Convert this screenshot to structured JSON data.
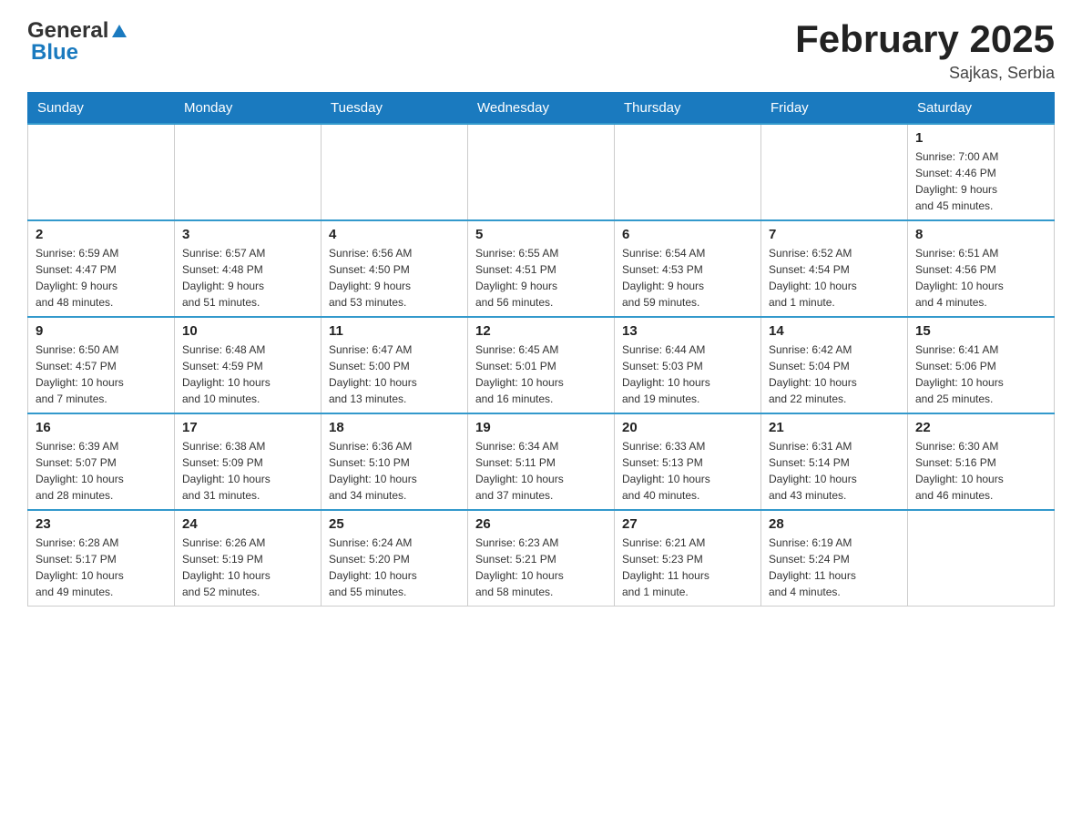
{
  "header": {
    "logo_general": "General",
    "logo_blue": "Blue",
    "title": "February 2025",
    "subtitle": "Sajkas, Serbia"
  },
  "days_of_week": [
    "Sunday",
    "Monday",
    "Tuesday",
    "Wednesday",
    "Thursday",
    "Friday",
    "Saturday"
  ],
  "weeks": [
    {
      "days": [
        {
          "num": "",
          "info": ""
        },
        {
          "num": "",
          "info": ""
        },
        {
          "num": "",
          "info": ""
        },
        {
          "num": "",
          "info": ""
        },
        {
          "num": "",
          "info": ""
        },
        {
          "num": "",
          "info": ""
        },
        {
          "num": "1",
          "info": "Sunrise: 7:00 AM\nSunset: 4:46 PM\nDaylight: 9 hours\nand 45 minutes."
        }
      ]
    },
    {
      "days": [
        {
          "num": "2",
          "info": "Sunrise: 6:59 AM\nSunset: 4:47 PM\nDaylight: 9 hours\nand 48 minutes."
        },
        {
          "num": "3",
          "info": "Sunrise: 6:57 AM\nSunset: 4:48 PM\nDaylight: 9 hours\nand 51 minutes."
        },
        {
          "num": "4",
          "info": "Sunrise: 6:56 AM\nSunset: 4:50 PM\nDaylight: 9 hours\nand 53 minutes."
        },
        {
          "num": "5",
          "info": "Sunrise: 6:55 AM\nSunset: 4:51 PM\nDaylight: 9 hours\nand 56 minutes."
        },
        {
          "num": "6",
          "info": "Sunrise: 6:54 AM\nSunset: 4:53 PM\nDaylight: 9 hours\nand 59 minutes."
        },
        {
          "num": "7",
          "info": "Sunrise: 6:52 AM\nSunset: 4:54 PM\nDaylight: 10 hours\nand 1 minute."
        },
        {
          "num": "8",
          "info": "Sunrise: 6:51 AM\nSunset: 4:56 PM\nDaylight: 10 hours\nand 4 minutes."
        }
      ]
    },
    {
      "days": [
        {
          "num": "9",
          "info": "Sunrise: 6:50 AM\nSunset: 4:57 PM\nDaylight: 10 hours\nand 7 minutes."
        },
        {
          "num": "10",
          "info": "Sunrise: 6:48 AM\nSunset: 4:59 PM\nDaylight: 10 hours\nand 10 minutes."
        },
        {
          "num": "11",
          "info": "Sunrise: 6:47 AM\nSunset: 5:00 PM\nDaylight: 10 hours\nand 13 minutes."
        },
        {
          "num": "12",
          "info": "Sunrise: 6:45 AM\nSunset: 5:01 PM\nDaylight: 10 hours\nand 16 minutes."
        },
        {
          "num": "13",
          "info": "Sunrise: 6:44 AM\nSunset: 5:03 PM\nDaylight: 10 hours\nand 19 minutes."
        },
        {
          "num": "14",
          "info": "Sunrise: 6:42 AM\nSunset: 5:04 PM\nDaylight: 10 hours\nand 22 minutes."
        },
        {
          "num": "15",
          "info": "Sunrise: 6:41 AM\nSunset: 5:06 PM\nDaylight: 10 hours\nand 25 minutes."
        }
      ]
    },
    {
      "days": [
        {
          "num": "16",
          "info": "Sunrise: 6:39 AM\nSunset: 5:07 PM\nDaylight: 10 hours\nand 28 minutes."
        },
        {
          "num": "17",
          "info": "Sunrise: 6:38 AM\nSunset: 5:09 PM\nDaylight: 10 hours\nand 31 minutes."
        },
        {
          "num": "18",
          "info": "Sunrise: 6:36 AM\nSunset: 5:10 PM\nDaylight: 10 hours\nand 34 minutes."
        },
        {
          "num": "19",
          "info": "Sunrise: 6:34 AM\nSunset: 5:11 PM\nDaylight: 10 hours\nand 37 minutes."
        },
        {
          "num": "20",
          "info": "Sunrise: 6:33 AM\nSunset: 5:13 PM\nDaylight: 10 hours\nand 40 minutes."
        },
        {
          "num": "21",
          "info": "Sunrise: 6:31 AM\nSunset: 5:14 PM\nDaylight: 10 hours\nand 43 minutes."
        },
        {
          "num": "22",
          "info": "Sunrise: 6:30 AM\nSunset: 5:16 PM\nDaylight: 10 hours\nand 46 minutes."
        }
      ]
    },
    {
      "days": [
        {
          "num": "23",
          "info": "Sunrise: 6:28 AM\nSunset: 5:17 PM\nDaylight: 10 hours\nand 49 minutes."
        },
        {
          "num": "24",
          "info": "Sunrise: 6:26 AM\nSunset: 5:19 PM\nDaylight: 10 hours\nand 52 minutes."
        },
        {
          "num": "25",
          "info": "Sunrise: 6:24 AM\nSunset: 5:20 PM\nDaylight: 10 hours\nand 55 minutes."
        },
        {
          "num": "26",
          "info": "Sunrise: 6:23 AM\nSunset: 5:21 PM\nDaylight: 10 hours\nand 58 minutes."
        },
        {
          "num": "27",
          "info": "Sunrise: 6:21 AM\nSunset: 5:23 PM\nDaylight: 11 hours\nand 1 minute."
        },
        {
          "num": "28",
          "info": "Sunrise: 6:19 AM\nSunset: 5:24 PM\nDaylight: 11 hours\nand 4 minutes."
        },
        {
          "num": "",
          "info": ""
        }
      ]
    }
  ]
}
